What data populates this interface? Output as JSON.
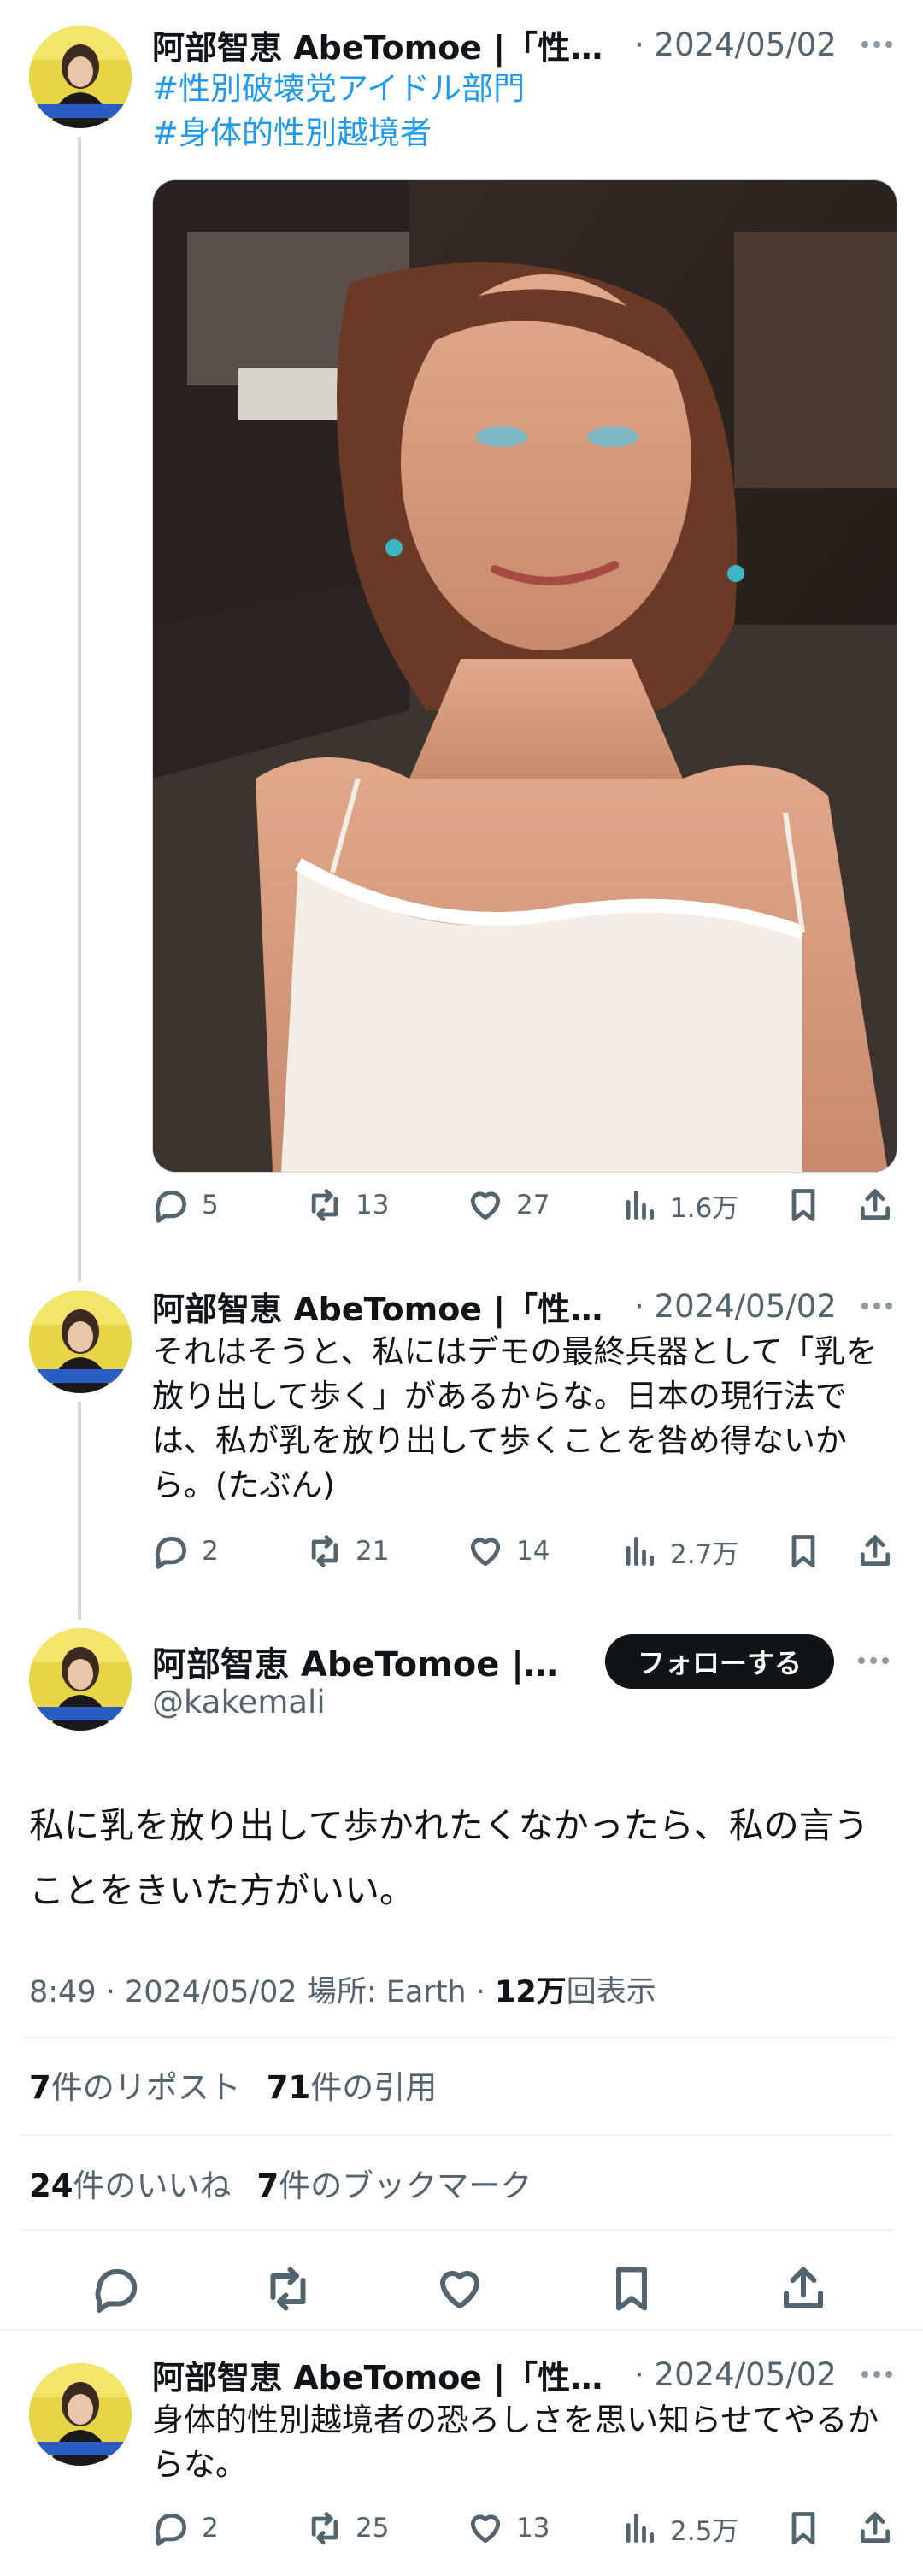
{
  "author": {
    "display_name": "阿部智恵 AbeTomoe |「性別…",
    "main_display_name": "阿部智恵 AbeTomoe |「性...",
    "handle": "@kakemali"
  },
  "tweet1": {
    "date": "· 2024/05/02",
    "hashtag1": "#性別破壊党アイドル部門",
    "hashtag2": "#身体的性別越境者",
    "replies": "5",
    "reposts": "13",
    "likes": "27",
    "views": "1.6万"
  },
  "tweet2": {
    "date": "· 2024/05/02",
    "text": "それはそうと、私にはデモの最終兵器として「乳を放り出して歩く」があるからな。日本の現行法では、私が乳を放り出して歩くことを咎め得ないから。(たぶん)",
    "replies": "2",
    "reposts": "21",
    "likes": "14",
    "views": "2.7万"
  },
  "main_tweet": {
    "follow_label": "フォローする",
    "text": "私に乳を放り出して歩かれたくなかったら、私の言うことをきいた方がいい。",
    "meta_prefix": "8:49 · 2024/05/02 場所: Earth · ",
    "views_count": "12万",
    "views_suffix": "回表示",
    "reposts_count": "7",
    "reposts_label": "件のリポスト",
    "quotes_count": "71",
    "quotes_label": "件の引用",
    "likes_count": "24",
    "likes_label": "件のいいね",
    "bookmarks_count": "7",
    "bookmarks_label": "件のブックマーク"
  },
  "tweet3": {
    "date": "· 2024/05/02",
    "text": "身体的性別越境者の恐ろしさを思い知らせてやるからな。",
    "replies": "2",
    "reposts": "25",
    "likes": "13",
    "views": "2.5万"
  },
  "colors": {
    "link": "#1d9bf0",
    "muted": "#536471",
    "text": "#0f1419",
    "thread_line": "#cfd9de"
  }
}
